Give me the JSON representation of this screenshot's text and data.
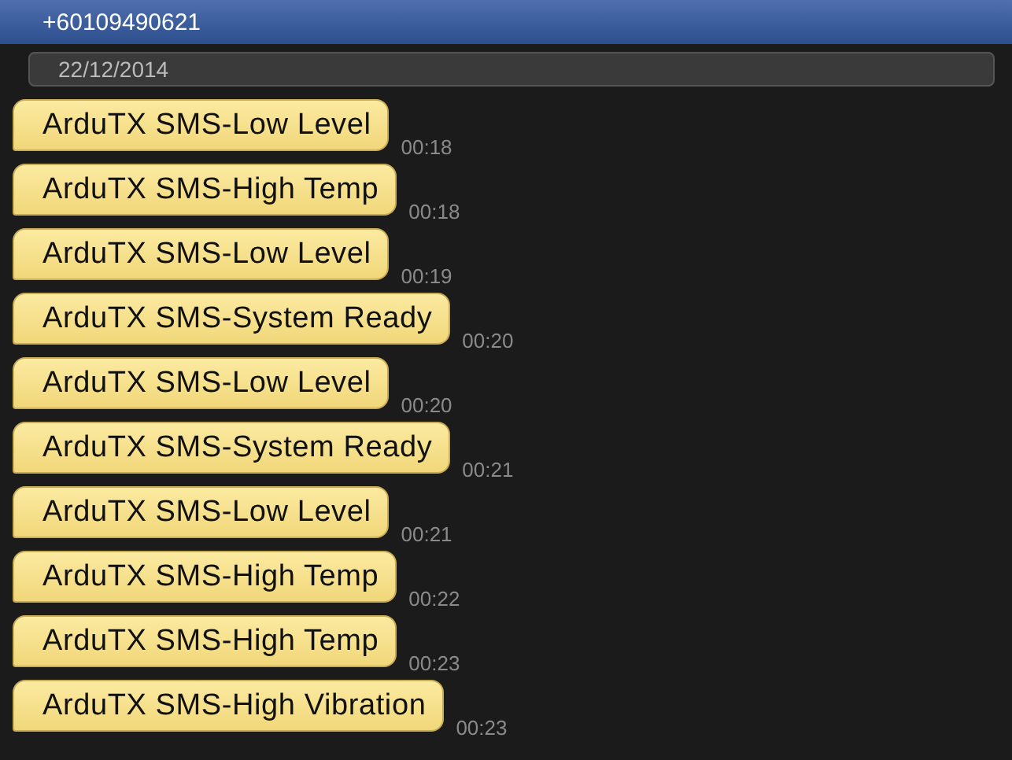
{
  "header": {
    "title": "+60109490621"
  },
  "date_separator": "22/12/2014",
  "messages": [
    {
      "text": "ArduTX SMS-Low Level",
      "time": "00:18"
    },
    {
      "text": "ArduTX SMS-High Temp",
      "time": "00:18"
    },
    {
      "text": "ArduTX SMS-Low Level",
      "time": "00:19"
    },
    {
      "text": "ArduTX SMS-System Ready",
      "time": "00:20"
    },
    {
      "text": "ArduTX SMS-Low Level",
      "time": "00:20"
    },
    {
      "text": "ArduTX SMS-System Ready",
      "time": "00:21"
    },
    {
      "text": "ArduTX SMS-Low Level",
      "time": "00:21"
    },
    {
      "text": "ArduTX SMS-High Temp",
      "time": "00:22"
    },
    {
      "text": "ArduTX SMS-High Temp",
      "time": "00:23"
    },
    {
      "text": "ArduTX SMS-High Vibration",
      "time": "00:23"
    }
  ]
}
